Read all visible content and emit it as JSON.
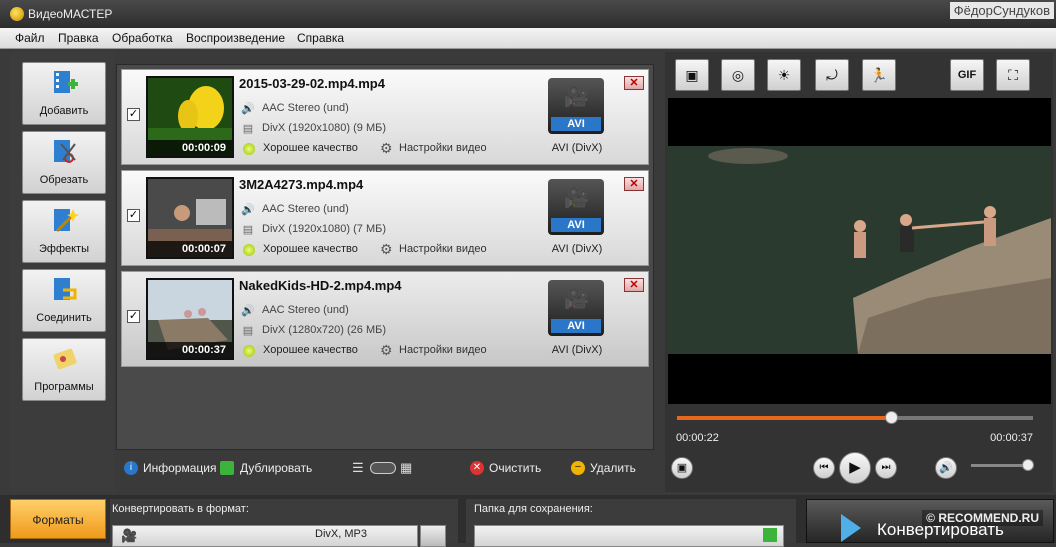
{
  "window": {
    "title": "ВидеоМАСТЕР",
    "user": "ФёдорСундуков"
  },
  "menu": [
    "Файл",
    "Правка",
    "Обработка",
    "Воспроизведение",
    "Справка"
  ],
  "tools": [
    {
      "label": "Добавить",
      "icon": "film-add-icon"
    },
    {
      "label": "Обрезать",
      "icon": "scissors-film-icon"
    },
    {
      "label": "Эффекты",
      "icon": "magic-wand-icon"
    },
    {
      "label": "Соединить",
      "icon": "join-film-icon"
    },
    {
      "label": "Программы",
      "icon": "programs-icon"
    }
  ],
  "files": [
    {
      "name": "2015-03-29-02.mp4.mp4",
      "audio": "AAC Stereo (und)",
      "video": "DivX (1920x1080) (9 МБ)",
      "quality": "Хорошее качество",
      "settings": "Настройки видео",
      "duration": "00:00:09",
      "format_tag": "AVI",
      "format_name": "AVI (DivX)"
    },
    {
      "name": "3M2A4273.mp4.mp4",
      "audio": "AAC Stereo (und)",
      "video": "DivX (1920x1080) (7 МБ)",
      "quality": "Хорошее качество",
      "settings": "Настройки видео",
      "duration": "00:00:07",
      "format_tag": "AVI",
      "format_name": "AVI (DivX)"
    },
    {
      "name": "NakedKids-HD-2.mp4.mp4",
      "audio": "AAC Stereo (und)",
      "video": "DivX (1280x720) (26 МБ)",
      "quality": "Хорошее качество",
      "settings": "Настройки видео",
      "duration": "00:00:37",
      "format_tag": "AVI",
      "format_name": "AVI (DivX)"
    }
  ],
  "list_actions": {
    "info": "Информация",
    "duplicate": "Дублировать",
    "clear": "Очистить",
    "delete": "Удалить"
  },
  "player": {
    "current": "00:00:22",
    "total": "00:00:37",
    "progress": 0.6,
    "volume": 0.95,
    "gif_label": "GIF"
  },
  "footer": {
    "formats": "Форматы",
    "convert_to": "Конвертировать в формат:",
    "format_sub": "DivX, MP3",
    "save_folder": "Папка для сохранения:",
    "convert": "Конвертировать",
    "watermark": "© RECOMMEND.RU"
  },
  "colors": {
    "accent": "#e8671f",
    "format_tag": "#2a77c9",
    "formats_button": "#f09a1a"
  }
}
